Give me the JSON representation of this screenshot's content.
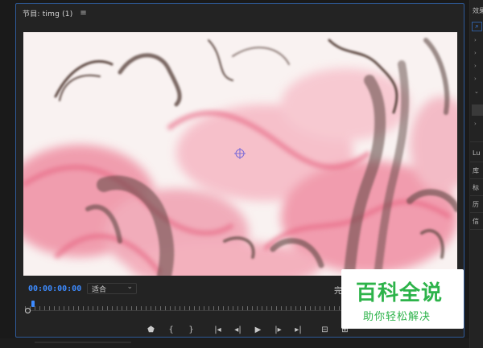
{
  "program_monitor": {
    "title": "节目: timg (1)",
    "menu_icon": "hamburger-icon",
    "timecode": "00:00:00:00",
    "fit_value": "适合",
    "fit_chevron": "⌄",
    "quality_label": "完",
    "accent_color": "#3d8bff"
  },
  "transport": [
    {
      "name": "add-marker-button",
      "glyph": "⬟"
    },
    {
      "name": "mark-in-button",
      "glyph": "{"
    },
    {
      "name": "mark-out-button",
      "glyph": "}"
    },
    {
      "name": "go-to-in-button",
      "glyph": "|◂"
    },
    {
      "name": "step-back-button",
      "glyph": "◂|"
    },
    {
      "name": "play-button",
      "glyph": "▶"
    },
    {
      "name": "step-forward-button",
      "glyph": "|▸"
    },
    {
      "name": "go-to-out-button",
      "glyph": "▸|"
    },
    {
      "name": "insert-button",
      "glyph": "⊟"
    },
    {
      "name": "overwrite-button",
      "glyph": "⊞"
    }
  ],
  "right_panel": {
    "top_label": "效果",
    "search_glyph": "⌕",
    "items": [
      "Lu",
      "库",
      "标",
      "历",
      "信"
    ]
  },
  "watermark": {
    "title": "百科全说",
    "subtitle": "助你轻松解决"
  }
}
